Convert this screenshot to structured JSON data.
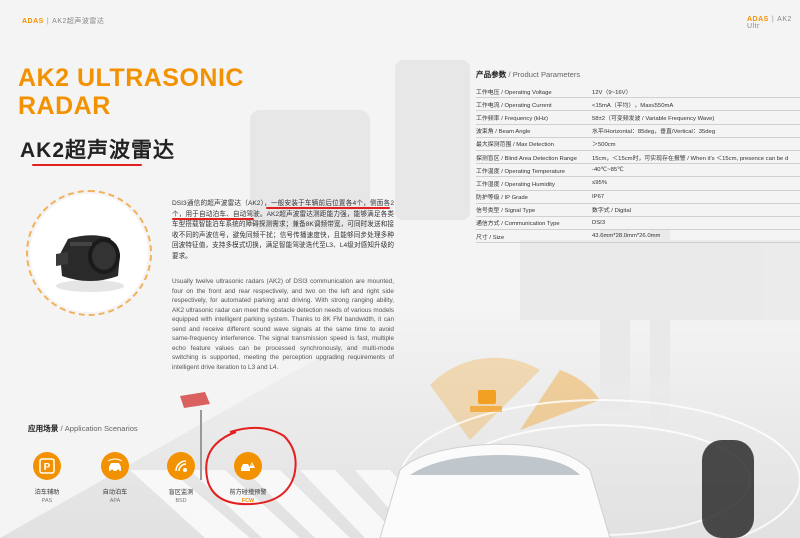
{
  "header": {
    "brand": "ADAS",
    "separator": "|",
    "title": "AK2超声波雷达",
    "right_brand": "ADAS",
    "right_title": "AK2 Ultr"
  },
  "hero": {
    "title_line1": "AK2 ULTRASONIC",
    "title_line2": "RADAR",
    "cn_title": "AK2超声波雷达"
  },
  "description": {
    "cn": "DSI3通信的超声波雷达（AK2），一般安装于车辆前后位置各4个，侧面各2个，用于自动泊车、自动驾驶。AK2超声波雷达测距能力强，能够满足各类车型搭载智能泊车系统的障碍探测需求；兼备8K调频带宽，可同时发送和接收不同的声波信号，避免同频干扰；信号传播速度快，且能够同步处理多种回波特征值，支持多模式切换，满足智能驾驶迭代至L3、L4级对感知升级的要求。",
    "en": "Usually twelve ultrasonic radars (AK2) of DSI3 communication are mounted, four on the front and rear respectively, and two on the left and right side respectively, for automated parking and driving. With strong ranging ability, AK2 ultrasonic radar can meet the obstacle detection needs of various models equipped with intelligent parking system. Thanks to 8K FM bandwidth, it can send and receive different sound wave signals at the same time to avoid same-frequency interference. The signal transmission speed is fast, multiple echo feature values can be processed synchronously, and multi-mode switching is supported, meeting the perception upgrading requirements of intelligent drive iteration to L3 and L4."
  },
  "params": {
    "title_cn": "产品参数",
    "title_en": " / Product Parameters",
    "rows": [
      {
        "k": "工作电压 / Operating Voltage",
        "v": "12V（9~16V）"
      },
      {
        "k": "工作电流 / Operating Current",
        "v": "<15mA（平均），Max≤550mA"
      },
      {
        "k": "工作频率 / Frequency (kHz)",
        "v": "58±2（可变频发波 / Variable Frequency Wave)"
      },
      {
        "k": "波束角 / Beam Angle",
        "v": "水平/Horizontal：85deg，垂直/Vertical：35deg"
      },
      {
        "k": "最大探测范围 / Max Detection",
        "v": "＞500cm"
      },
      {
        "k": "探测盲区 / Blind Area Detection Range",
        "v": "15cm，＜15cm时，可实现存在报警 / When it's ＜15cm, presence can be d"
      },
      {
        "k": "工作温度 / Operating Temperature",
        "v": "-40℃~85℃"
      },
      {
        "k": "工作湿度 / Operating Humidity",
        "v": "≤95%"
      },
      {
        "k": "防护等级 / IP Grade",
        "v": "IP67"
      },
      {
        "k": "信号类型 / Signal Type",
        "v": "数字式 / Digital"
      },
      {
        "k": "通信方式 / Communication Type",
        "v": "DSI3"
      },
      {
        "k": "尺寸 / Size",
        "v": "43.6mm*28.0mm*26.0mm"
      }
    ]
  },
  "scenarios": {
    "title_cn": "应用场景",
    "title_en": " / Application Scenarios",
    "items": [
      {
        "cn": "泊车辅助",
        "en": "PAS",
        "icon": "parking-icon"
      },
      {
        "cn": "自动泊车",
        "en": "APA",
        "icon": "auto-parking-icon"
      },
      {
        "cn": "盲区监测",
        "en": "BSD",
        "icon": "blind-spot-icon"
      },
      {
        "cn": "前方碰撞预警",
        "en": "FCW",
        "icon": "collision-warning-icon"
      }
    ]
  },
  "colors": {
    "accent": "#f39200",
    "annotation": "#e32020",
    "text": "#333333"
  }
}
